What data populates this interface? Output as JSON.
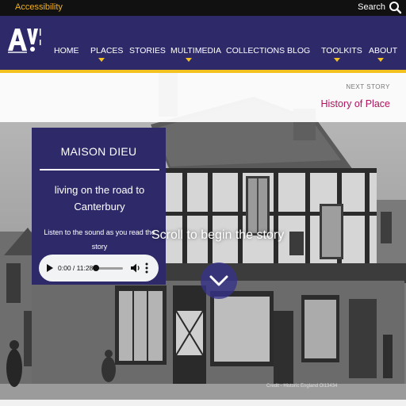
{
  "topbar": {
    "accessibility": "Accessibility",
    "search": "Search"
  },
  "nav": {
    "home": "HOME",
    "places": "PLACES",
    "stories": "STORIES",
    "multimedia": "MULTIMEDIA",
    "collections": "COLLECTIONS",
    "blog": "BLOG",
    "toolkits": "TOOLKITS",
    "about": "ABOUT"
  },
  "next": {
    "label": "NEXT STORY",
    "title": "History of Place"
  },
  "card": {
    "title": "MAISON DIEU",
    "subtitle": "living on the road to Canterbury",
    "instruction": "Listen to the sound as you read the story"
  },
  "audio": {
    "time": "0:00 / 11:28",
    "progress": 0
  },
  "hero": {
    "scroll_text": "Scroll to begin the story",
    "credit": "Credit - Historic England Ol13434"
  },
  "colors": {
    "navy": "#2e2a6a",
    "gold": "#f3c221",
    "accent": "#b0125d"
  }
}
